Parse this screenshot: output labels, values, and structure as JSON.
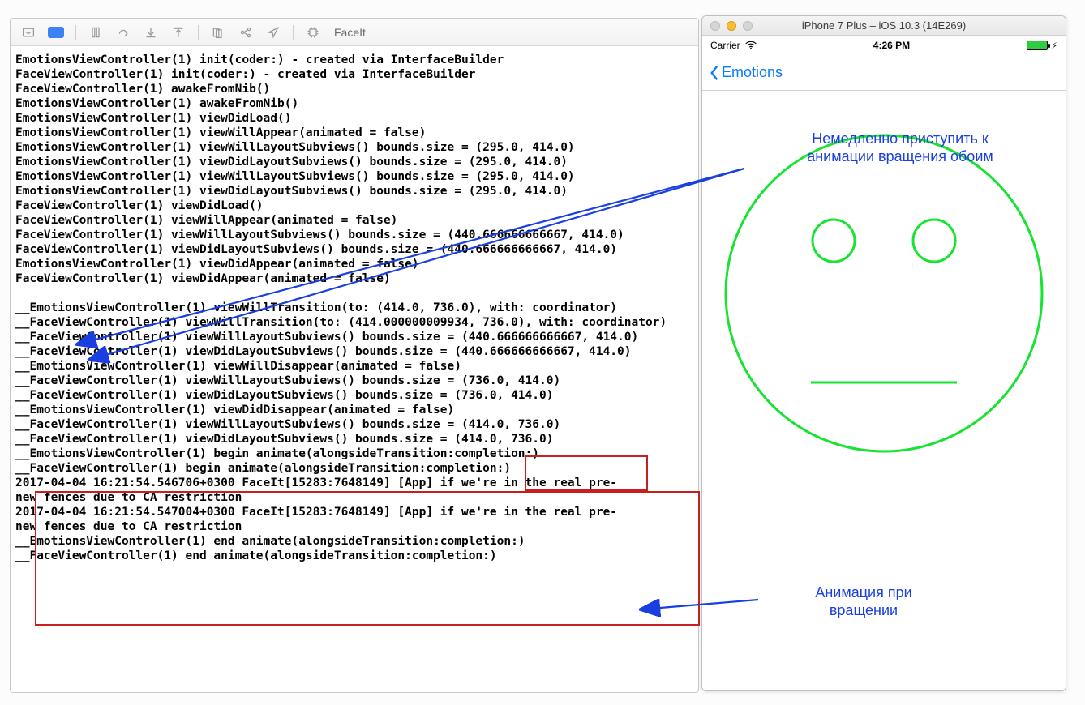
{
  "toolbar": {
    "scheme": "FaceIt"
  },
  "sim": {
    "window_title": "iPhone 7 Plus – iOS 10.3 (14E269)",
    "carrier": "Carrier",
    "time": "4:26 PM",
    "charging": "⚡︎",
    "back_label": "Emotions"
  },
  "annotations": {
    "top": "Немедленно приступить к\nанимации вращения обоим",
    "bottom": "Анимация при\nвращении"
  },
  "log_lines": [
    "EmotionsViewController(1) init(coder:) - created via InterfaceBuilder",
    "FaceViewController(1) init(coder:) - created via InterfaceBuilder",
    "FaceViewController(1) awakeFromNib()",
    "EmotionsViewController(1) awakeFromNib()",
    "EmotionsViewController(1) viewDidLoad()",
    "EmotionsViewController(1) viewWillAppear(animated = false)",
    "EmotionsViewController(1) viewWillLayoutSubviews() bounds.size = (295.0, 414.0)",
    "EmotionsViewController(1) viewDidLayoutSubviews() bounds.size = (295.0, 414.0)",
    "EmotionsViewController(1) viewWillLayoutSubviews() bounds.size = (295.0, 414.0)",
    "EmotionsViewController(1) viewDidLayoutSubviews() bounds.size = (295.0, 414.0)",
    "FaceViewController(1) viewDidLoad()",
    "FaceViewController(1) viewWillAppear(animated = false)",
    "FaceViewController(1) viewWillLayoutSubviews() bounds.size = (440.666666666667, 414.0)",
    "FaceViewController(1) viewDidLayoutSubviews() bounds.size = (440.666666666667, 414.0)",
    "EmotionsViewController(1) viewDidAppear(animated = false)",
    "FaceViewController(1) viewDidAppear(animated = false)",
    "",
    "__EmotionsViewController(1) viewWillTransition(to: (414.0, 736.0), with: coordinator)",
    "__FaceViewController(1) viewWillTransition(to: (414.000000009934, 736.0), with: coordinator)",
    "__FaceViewController(1) viewWillLayoutSubviews() bounds.size = (440.666666666667, 414.0)",
    "__FaceViewController(1) viewDidLayoutSubviews() bounds.size = (440.666666666667, 414.0)",
    "__EmotionsViewController(1) viewWillDisappear(animated = false)",
    "__FaceViewController(1) viewWillLayoutSubviews() bounds.size = (736.0, 414.0)",
    "__FaceViewController(1) viewDidLayoutSubviews() bounds.size = (736.0, 414.0)",
    "__EmotionsViewController(1) viewDidDisappear(animated = false)",
    "__FaceViewController(1) viewWillLayoutSubviews() bounds.size = (414.0, 736.0)",
    "__FaceViewController(1) viewDidLayoutSubviews() bounds.size = (414.0, 736.0)",
    "__EmotionsViewController(1) begin animate(alongsideTransition:completion:)",
    "__FaceViewController(1) begin animate(alongsideTransition:completion:)",
    "2017-04-04 16:21:54.546706+0300 FaceIt[15283:7648149] [App] if we're in the real pre-",
    "new fences due to CA restriction",
    "2017-04-04 16:21:54.547004+0300 FaceIt[15283:7648149] [App] if we're in the real pre-",
    "new fences due to CA restriction",
    "__EmotionsViewController(1) end animate(alongsideTransition:completion:)",
    "__FaceViewController(1) end animate(alongsideTransition:completion:)"
  ]
}
